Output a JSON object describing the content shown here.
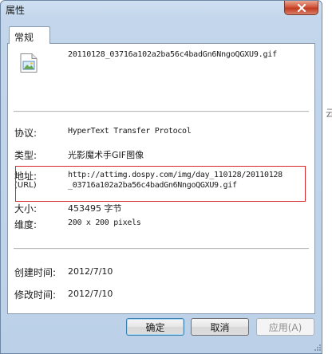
{
  "window": {
    "title": "属性",
    "close_icon": "close-icon"
  },
  "tabs": [
    {
      "label": "常规",
      "active": true
    }
  ],
  "file": {
    "icon": "gif-image-file-icon",
    "name": "20110128_03716a102a2ba56c4badGn6NngoQGXU9.gif"
  },
  "properties": {
    "protocol": {
      "label": "协议:",
      "value": "HyperText Transfer Protocol"
    },
    "type": {
      "label": "类型:",
      "value": "光影魔术手GIF图像"
    },
    "address": {
      "label": "地址:",
      "sublabel": "(URL)",
      "value_line1": "http://attimg.dospy.com/img/day_110128/20110128",
      "value_line2": "_03716a102a2ba56c4badGn6NngoQGXU9.gif"
    },
    "size": {
      "label": "大小:",
      "value": "453495 字节"
    },
    "dimensions": {
      "label": "维度:",
      "value": "200  x  200  pixels"
    },
    "created": {
      "label": "创建时间:",
      "value": "2012/7/10"
    },
    "modified": {
      "label": "修改时间:",
      "value": "2012/7/10"
    }
  },
  "buttons": {
    "ok": "确定",
    "cancel": "取消",
    "apply": "应用(A)"
  },
  "background_fragment": "云",
  "colors": {
    "highlight_border": "#d9262b",
    "titlebar": "#c3d6eb",
    "close_button": "#c23a1f"
  }
}
